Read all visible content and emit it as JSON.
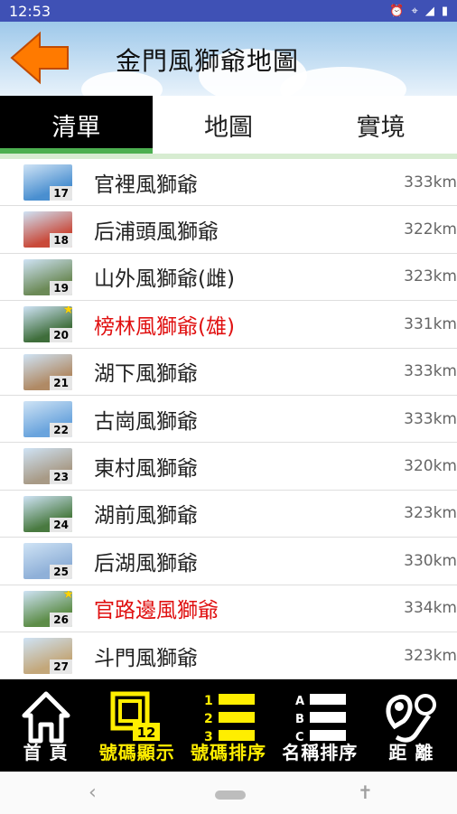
{
  "status": {
    "time": "12:53"
  },
  "header": {
    "title": "金門風獅爺地圖"
  },
  "tabs": [
    {
      "label": "清單",
      "active": true
    },
    {
      "label": "地圖",
      "active": false
    },
    {
      "label": "實境",
      "active": false
    }
  ],
  "items": [
    {
      "num": "17",
      "name": "官裡風獅爺",
      "dist": "333km",
      "highlight": false,
      "star": false,
      "color": "#4a8fd0"
    },
    {
      "num": "18",
      "name": "后浦頭風獅爺",
      "dist": "322km",
      "highlight": false,
      "star": false,
      "color": "#c94a3a"
    },
    {
      "num": "19",
      "name": "山外風獅爺(雌)",
      "dist": "323km",
      "highlight": false,
      "star": false,
      "color": "#6c8a57"
    },
    {
      "num": "20",
      "name": "榜林風獅爺(雄)",
      "dist": "331km",
      "highlight": true,
      "star": true,
      "color": "#3f6e3b"
    },
    {
      "num": "21",
      "name": "湖下風獅爺",
      "dist": "333km",
      "highlight": false,
      "star": false,
      "color": "#b08a65"
    },
    {
      "num": "22",
      "name": "古崗風獅爺",
      "dist": "333km",
      "highlight": false,
      "star": false,
      "color": "#6aa4dd"
    },
    {
      "num": "23",
      "name": "東村風獅爺",
      "dist": "320km",
      "highlight": false,
      "star": false,
      "color": "#a89a86"
    },
    {
      "num": "24",
      "name": "湖前風獅爺",
      "dist": "323km",
      "highlight": false,
      "star": false,
      "color": "#497a40"
    },
    {
      "num": "25",
      "name": "后湖風獅爺",
      "dist": "330km",
      "highlight": false,
      "star": false,
      "color": "#8fb0d8"
    },
    {
      "num": "26",
      "name": "官路邊風獅爺",
      "dist": "334km",
      "highlight": true,
      "star": true,
      "color": "#5d8d48"
    },
    {
      "num": "27",
      "name": "斗門風獅爺",
      "dist": "323km",
      "highlight": false,
      "star": false,
      "color": "#c3a77a"
    }
  ],
  "bottom": {
    "home": "首 頁",
    "num_show": "號碼顯示",
    "num_show_badge": "12",
    "num_sort": "號碼排序",
    "name_sort": "名稱排序",
    "distance": "距 離"
  },
  "colors": {
    "status": "#3f51b5",
    "accent": "#ffee00",
    "highlight": "#e01010",
    "tab_active": "#000000",
    "tab_underline": "#4caf50"
  }
}
